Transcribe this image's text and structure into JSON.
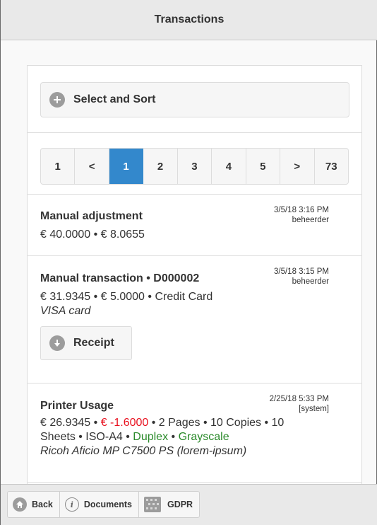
{
  "header": {
    "title": "Transactions"
  },
  "select_sort": {
    "label": "Select and Sort",
    "icon": "plus-circle-icon"
  },
  "pager": {
    "items": [
      "1",
      "<",
      "1",
      "2",
      "3",
      "4",
      "5",
      ">",
      "73"
    ],
    "active_index": 2,
    "active_color": "#3388cc"
  },
  "transactions": [
    {
      "title": "Manual adjustment",
      "date": "3/5/18 3:16 PM",
      "user": "beheerder",
      "amounts": "€ 40.0000 • € 8.0655"
    },
    {
      "title": "Manual transaction • D000002",
      "date": "3/5/18 3:15 PM",
      "user": "beheerder",
      "amounts": "€ 31.9345 • € 5.0000 • Credit Card",
      "note": "VISA card",
      "receipt_label": "Receipt"
    },
    {
      "title": "Printer Usage",
      "date": "2/25/18 5:33 PM",
      "user": "[system]",
      "balance": "€ 26.9345",
      "sep1": " • ",
      "cost": "€ -1.6000",
      "details1": " • 2 Pages • 10 Copies • 10",
      "details2": "Sheets • ISO-A4 • ",
      "duplex": "Duplex",
      "sep2": " • ",
      "grayscale": "Grayscale",
      "printer": "Ricoh Aficio MP C7500 PS (lorem-ipsum)"
    }
  ],
  "footer": {
    "back_label": "Back",
    "documents_label": "Documents",
    "gdpr_label": "GDPR"
  },
  "colors": {
    "negative": "#e8101e",
    "positive": "#2a8a2a"
  }
}
